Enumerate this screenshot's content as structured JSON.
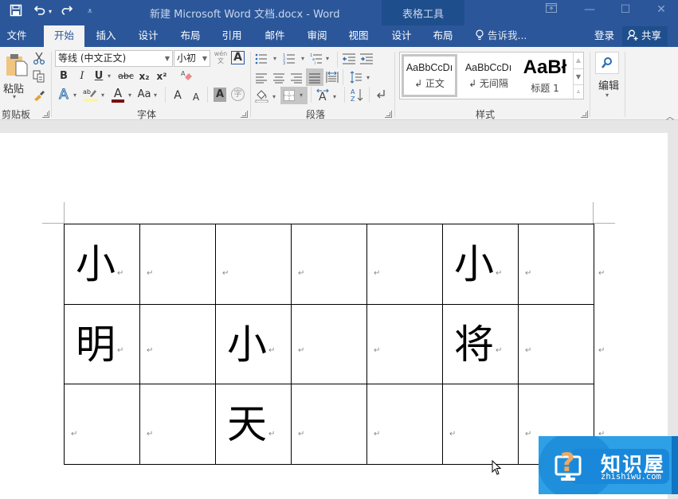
{
  "titlebar": {
    "doc_title": "新建 Microsoft Word 文档.docx - Word",
    "context_tools_title": "表格工具",
    "qat": {
      "save_icon": "save-icon",
      "undo_icon": "undo-icon",
      "redo_icon": "redo-icon",
      "customize_icon": "customize-qat-icon"
    },
    "window_controls": [
      "ribbon-display-options",
      "minimize",
      "maximize",
      "close"
    ]
  },
  "tabs": [
    {
      "label": "文件",
      "active": false
    },
    {
      "label": "开始",
      "active": true
    },
    {
      "label": "插入",
      "active": false
    },
    {
      "label": "设计",
      "active": false
    },
    {
      "label": "布局",
      "active": false
    },
    {
      "label": "引用",
      "active": false
    },
    {
      "label": "邮件",
      "active": false
    },
    {
      "label": "审阅",
      "active": false
    },
    {
      "label": "视图",
      "active": false
    },
    {
      "label": "设计",
      "active": false,
      "context": true
    },
    {
      "label": "布局",
      "active": false,
      "context": true
    }
  ],
  "tell_me": "告诉我...",
  "sign_in": "登录",
  "share": "共享",
  "ribbon": {
    "clipboard": {
      "label": "剪贴板",
      "paste": "粘贴",
      "buttons": [
        "cut",
        "copy",
        "format-painter"
      ]
    },
    "font": {
      "label": "字体",
      "font_name": "等线 (中文正文)",
      "font_size": "小初",
      "phonetic_guide": "wén\n文",
      "char_border": "A",
      "bold": "B",
      "italic": "I",
      "underline": "U",
      "strikethrough": "abc",
      "subscript": "x₂",
      "superscript": "x²",
      "text_effects": "A",
      "highlight_color": "#fff59d",
      "font_color": "#7b1010",
      "font_color_label": "A",
      "change_case": "Aa",
      "grow_font": "A",
      "shrink_font": "A",
      "char_shading": "A",
      "enclose_char": "字"
    },
    "paragraph": {
      "label": "段落"
    },
    "styles": {
      "label": "样式",
      "items": [
        {
          "sample": "AaBbCcDı",
          "name": "↲ 正文",
          "selected": true
        },
        {
          "sample": "AaBbCcDı",
          "name": "↲ 无间隔",
          "selected": false
        },
        {
          "sample": "AaBł",
          "name": "标题 1",
          "selected": false
        }
      ]
    },
    "editing": {
      "label": "编辑"
    }
  },
  "document": {
    "table": {
      "rows": [
        [
          "小",
          "",
          "",
          "",
          "",
          "小",
          ""
        ],
        [
          "明",
          "",
          "小",
          "",
          "",
          "将",
          ""
        ],
        [
          "",
          "",
          "天",
          "",
          "",
          "",
          ""
        ]
      ],
      "paragraph_mark": "↵"
    }
  },
  "watermark": {
    "title": "知识屋",
    "subtitle": "zhishiwu.com"
  },
  "colors": {
    "word_blue": "#2b579a",
    "context_tab_blue": "#1f4e8c",
    "ribbon_bg": "#f3f3f3",
    "canvas_bg": "#e6e6e6"
  }
}
